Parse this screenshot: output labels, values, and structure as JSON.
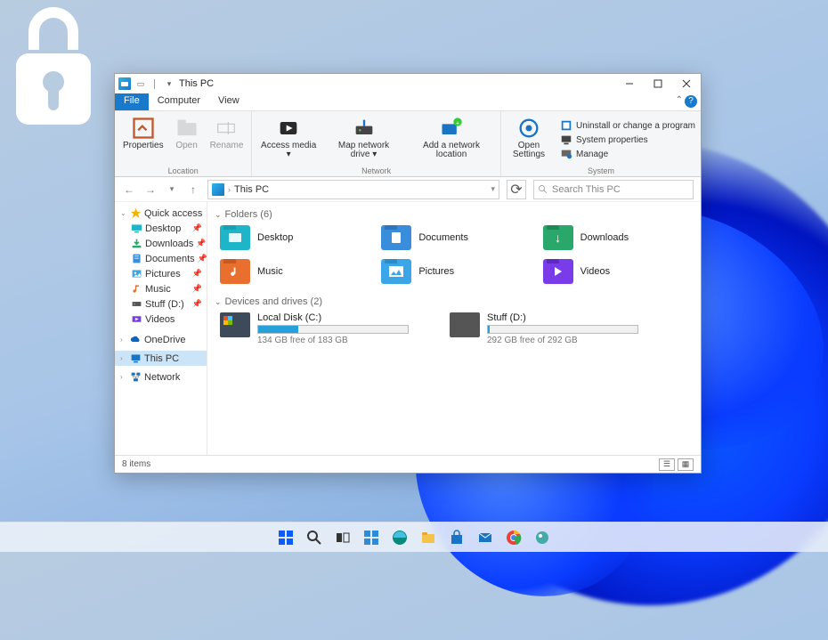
{
  "window": {
    "title": "This PC",
    "menu": {
      "file": "File",
      "computer": "Computer",
      "view": "View"
    },
    "ribbon": {
      "location_label": "Location",
      "network_label": "Network",
      "system_label": "System",
      "properties": "Properties",
      "open": "Open",
      "rename": "Rename",
      "access_media": "Access media ▾",
      "map_drive": "Map network drive ▾",
      "add_location": "Add a network location",
      "open_settings": "Open Settings",
      "uninstall": "Uninstall or change a program",
      "sys_props": "System properties",
      "manage": "Manage"
    },
    "nav": {
      "breadcrumb": "This PC",
      "search_placeholder": "Search This PC"
    },
    "status": {
      "items": "8 items"
    }
  },
  "sidebar": {
    "quick_access": "Quick access",
    "items": [
      {
        "label": "Desktop"
      },
      {
        "label": "Downloads"
      },
      {
        "label": "Documents"
      },
      {
        "label": "Pictures"
      },
      {
        "label": "Music"
      },
      {
        "label": "Stuff (D:)"
      },
      {
        "label": "Videos"
      }
    ],
    "onedrive": "OneDrive",
    "this_pc": "This PC",
    "network": "Network"
  },
  "main": {
    "folders_header": "Folders (6)",
    "folders": [
      {
        "label": "Desktop"
      },
      {
        "label": "Documents"
      },
      {
        "label": "Downloads"
      },
      {
        "label": "Music"
      },
      {
        "label": "Pictures"
      },
      {
        "label": "Videos"
      }
    ],
    "drives_header": "Devices and drives (2)",
    "drives": [
      {
        "name": "Local Disk (C:)",
        "free": "134 GB free of 183 GB",
        "fill_pct": 27
      },
      {
        "name": "Stuff (D:)",
        "free": "292 GB free of 292 GB",
        "fill_pct": 1
      }
    ]
  }
}
